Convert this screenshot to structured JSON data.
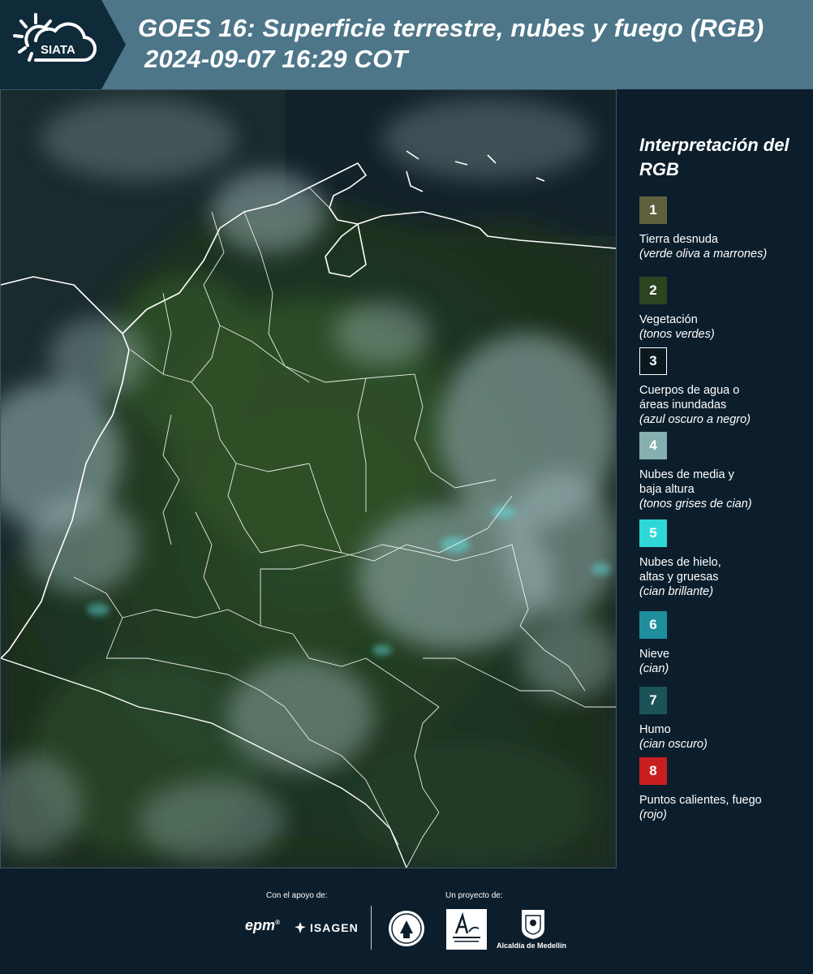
{
  "header": {
    "brand": "SIATA",
    "title_line1": "GOES 16: Superficie terrestre, nubes y fuego (RGB)",
    "title_line2": "2024-09-07 16:29 COT",
    "colors": {
      "band": "#4d7689",
      "logo_block": "#0f2a39"
    }
  },
  "map": {
    "icon": "satellite-rgb-map",
    "colors": {
      "vegetation": "#1f3a22",
      "cloud": "#9fb8bb",
      "border": "#ffffff"
    }
  },
  "legend": {
    "title": "Interpretación del RGB",
    "items": [
      {
        "number": "1",
        "label": "Tierra desnuda",
        "sub": "(verde oliva a marrones)",
        "color": "#60603f"
      },
      {
        "number": "2",
        "label": "Vegetación",
        "sub": "(tonos verdes)",
        "color": "#2d4421"
      },
      {
        "number": "3",
        "label": "Cuerpos de agua o\náreas inundadas",
        "sub": "(azul oscuro a negro)",
        "color": "#0b1820"
      },
      {
        "number": "4",
        "label": "Nubes de media y\nbaja altura",
        "sub": "(tonos grises de cian)",
        "color": "#86b0b0"
      },
      {
        "number": "5",
        "label": "Nubes de hielo,\naltas y gruesas",
        "sub": "(cian brillante)",
        "color": "#2fd8d8"
      },
      {
        "number": "6",
        "label": "Nieve",
        "sub": "(cian)",
        "color": "#1e8e9c"
      },
      {
        "number": "7",
        "label": "Humo",
        "sub": "(cian oscuro)",
        "color": "#1c5358"
      },
      {
        "number": "8",
        "label": "Puntos calientes, fuego",
        "sub": "(rojo)",
        "color": "#c81e1e"
      }
    ]
  },
  "footer": {
    "support_label": "Con el apoyo de:",
    "project_label": "Un proyecto de:",
    "sponsors": {
      "epm": "epm",
      "isagen": "ISAGEN"
    },
    "alcaldia": "Alcaldía de Medellín"
  }
}
